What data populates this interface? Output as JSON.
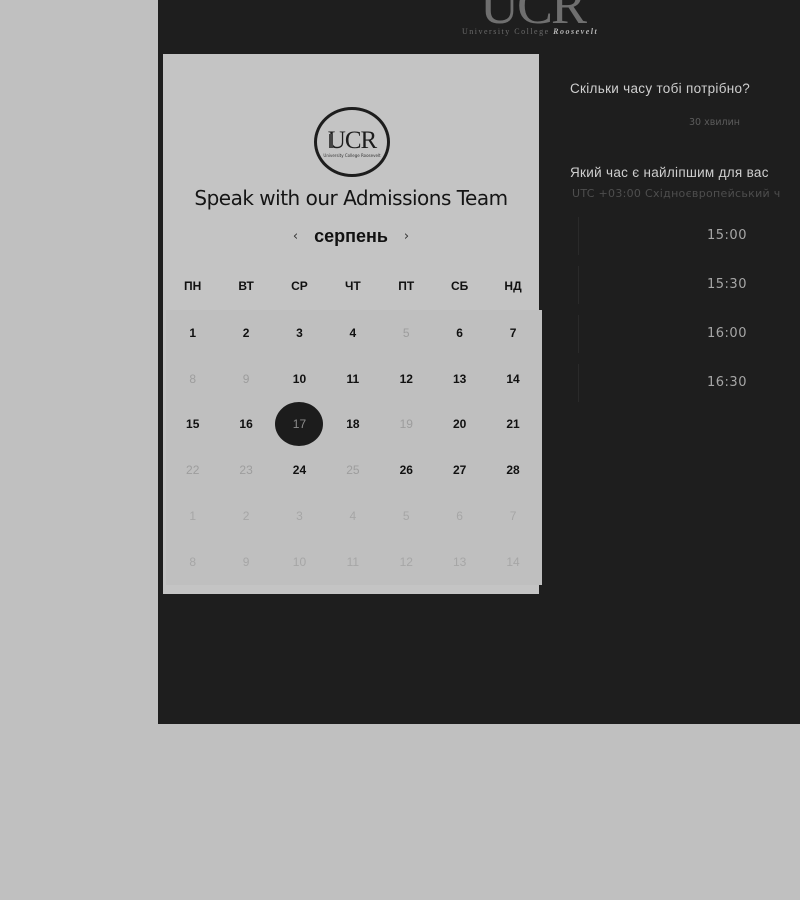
{
  "header": {
    "logo_letters": "UCR",
    "tagline_left": "University College",
    "tagline_right": "Roosevelt"
  },
  "card": {
    "logo_text": "UCR",
    "logo_small": "University College Roosevelt",
    "title": "Speak with our Admissions Team",
    "month": "серпень",
    "prev_icon": "chevron-left-icon",
    "next_icon": "chevron-right-icon",
    "weekdays": [
      "ПН",
      "ВТ",
      "СР",
      "ЧТ",
      "ПТ",
      "СБ",
      "НД"
    ],
    "weeks": [
      [
        {
          "d": "1",
          "s": "avail"
        },
        {
          "d": "2",
          "s": "avail"
        },
        {
          "d": "3",
          "s": "avail"
        },
        {
          "d": "4",
          "s": "avail"
        },
        {
          "d": "5",
          "s": "muted"
        },
        {
          "d": "6",
          "s": "avail"
        },
        {
          "d": "7",
          "s": "avail"
        }
      ],
      [
        {
          "d": "8",
          "s": "muted"
        },
        {
          "d": "9",
          "s": "muted"
        },
        {
          "d": "10",
          "s": "avail"
        },
        {
          "d": "11",
          "s": "avail"
        },
        {
          "d": "12",
          "s": "avail"
        },
        {
          "d": "13",
          "s": "avail"
        },
        {
          "d": "14",
          "s": "avail"
        }
      ],
      [
        {
          "d": "15",
          "s": "avail"
        },
        {
          "d": "16",
          "s": "avail"
        },
        {
          "d": "17",
          "s": "selected"
        },
        {
          "d": "18",
          "s": "avail"
        },
        {
          "d": "19",
          "s": "muted"
        },
        {
          "d": "20",
          "s": "avail"
        },
        {
          "d": "21",
          "s": "avail"
        }
      ],
      [
        {
          "d": "22",
          "s": "muted"
        },
        {
          "d": "23",
          "s": "muted"
        },
        {
          "d": "24",
          "s": "avail"
        },
        {
          "d": "25",
          "s": "muted"
        },
        {
          "d": "26",
          "s": "avail"
        },
        {
          "d": "27",
          "s": "avail"
        },
        {
          "d": "28",
          "s": "avail"
        }
      ],
      [
        {
          "d": "1",
          "s": "outside"
        },
        {
          "d": "2",
          "s": "outside"
        },
        {
          "d": "3",
          "s": "outside"
        },
        {
          "d": "4",
          "s": "outside"
        },
        {
          "d": "5",
          "s": "outside"
        },
        {
          "d": "6",
          "s": "outside"
        },
        {
          "d": "7",
          "s": "outside"
        }
      ],
      [
        {
          "d": "8",
          "s": "outside"
        },
        {
          "d": "9",
          "s": "outside"
        },
        {
          "d": "10",
          "s": "outside"
        },
        {
          "d": "11",
          "s": "outside"
        },
        {
          "d": "12",
          "s": "outside"
        },
        {
          "d": "13",
          "s": "outside"
        },
        {
          "d": "14",
          "s": "outside"
        }
      ]
    ]
  },
  "side": {
    "duration_question": "Скільки часу тобі потрібно?",
    "duration_value": "30 хвилин",
    "time_question": "Який час є найліпшим для вас",
    "timezone": "UTC +03:00 Східноєвропейський ч",
    "slots": [
      "15:00",
      "15:30",
      "16:00",
      "16:30"
    ]
  },
  "colors": {
    "page_bg": "#c0c0c0",
    "frame_bg": "#1e1e1e",
    "card_bg": "#c4c4c4",
    "selected_day": "#1c1c1c"
  }
}
